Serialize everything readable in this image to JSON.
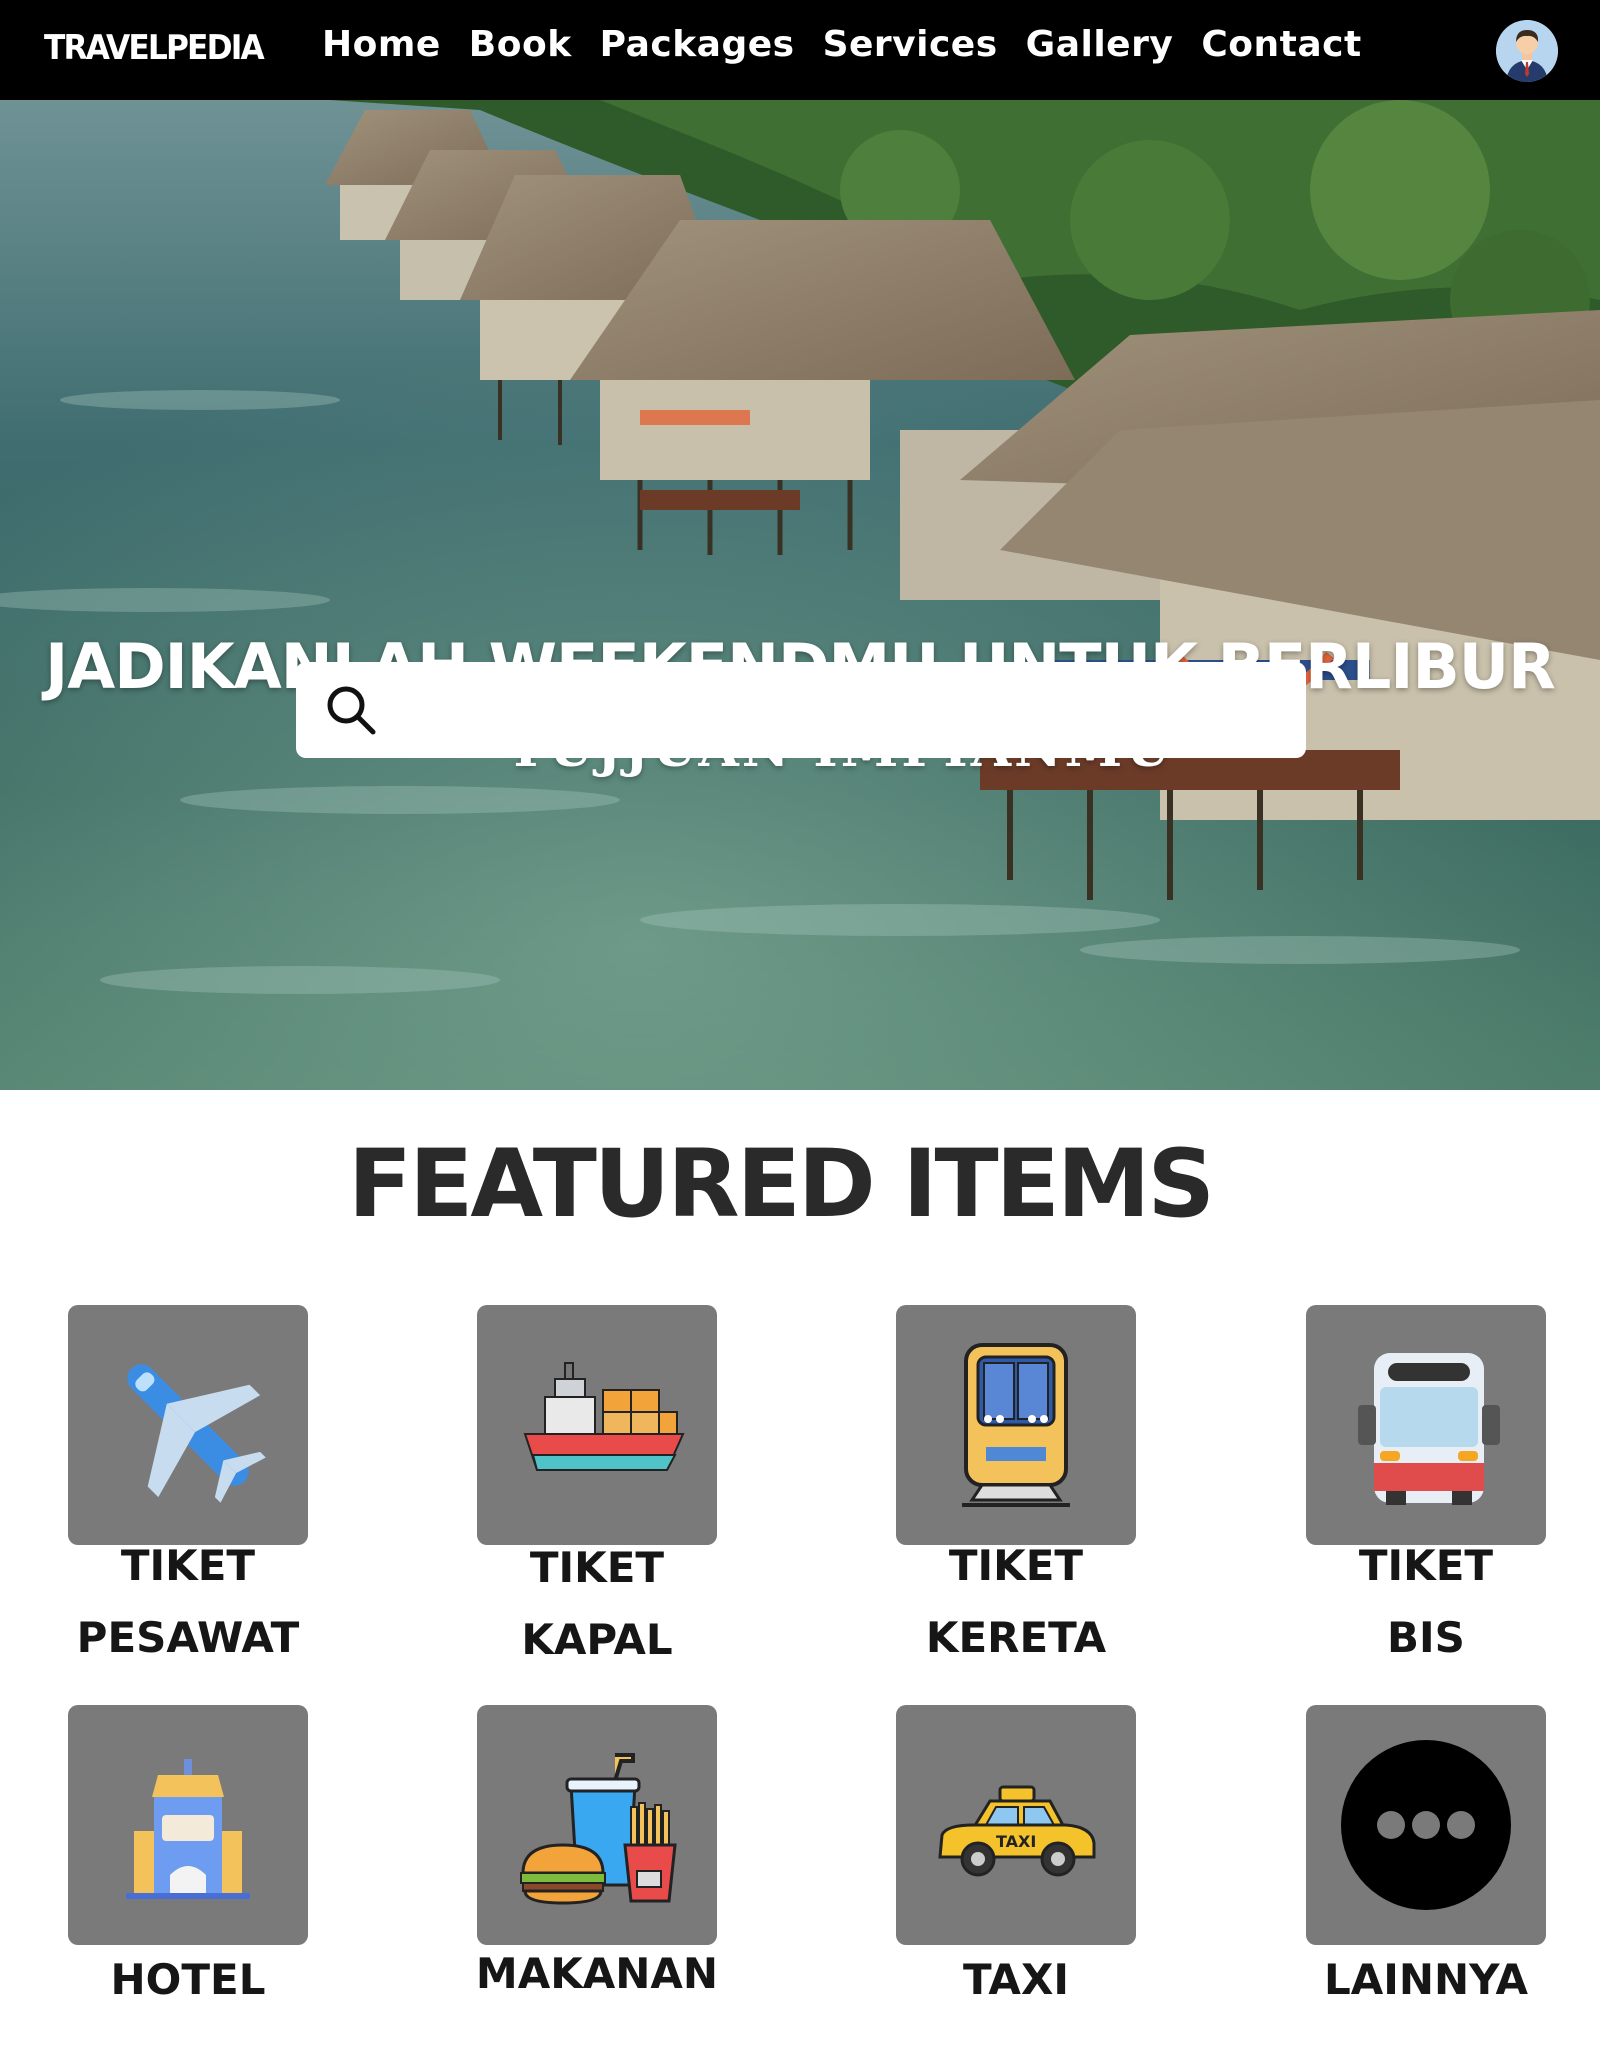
{
  "nav": {
    "logo": "TRAVELPEDIA",
    "links": [
      "Home",
      "Book",
      "Packages",
      "Services",
      "Gallery",
      "Contact"
    ]
  },
  "hero": {
    "title": "JADIKANLAH WEEKENDMU UNTUK BERLIBUR",
    "subtitle": "TUJJUAN IMPIANMU",
    "search_placeholder": ""
  },
  "featured": {
    "title": "FEATURED ITEMS",
    "items": [
      {
        "label_1": "TIKET",
        "label_2": "PESAWAT",
        "icon": "airplane-icon"
      },
      {
        "label_1": "TIKET",
        "label_2": "KAPAL",
        "icon": "ship-icon"
      },
      {
        "label_1": "TIKET",
        "label_2": "KERETA",
        "icon": "train-icon"
      },
      {
        "label_1": "TIKET",
        "label_2": "BIS",
        "icon": "bus-icon"
      },
      {
        "label_1": "HOTEL",
        "icon": "hotel-icon"
      },
      {
        "label_1": "MAKANAN",
        "icon": "food-icon"
      },
      {
        "label_1": "TAXI",
        "icon": "taxi-icon"
      },
      {
        "label_1": "LAINNYA",
        "icon": "more-icon"
      }
    ]
  },
  "colors": {
    "navbar_bg": "#000000",
    "tile_bg": "#7a7a7a",
    "heading": "#2a2a2a"
  }
}
